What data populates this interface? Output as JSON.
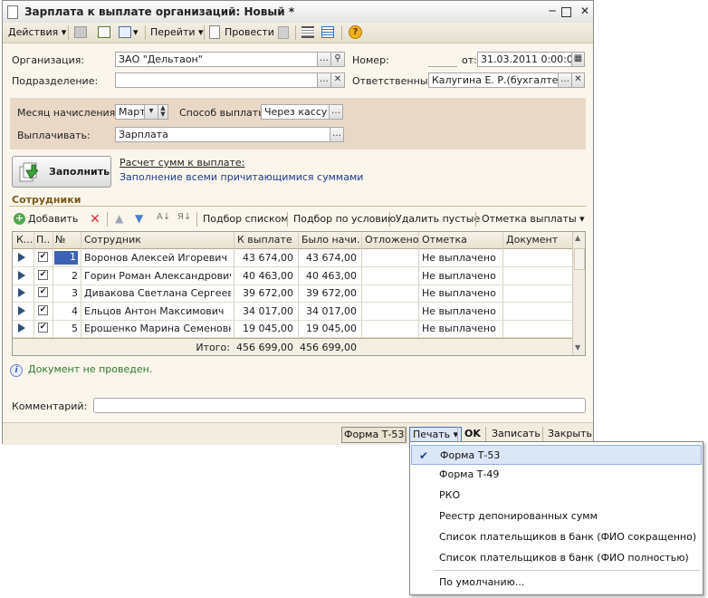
{
  "window": {
    "title": "Зарплата к выплате организаций: Новый *"
  },
  "toolbar": {
    "actions": "Действия",
    "goto": "Перейти",
    "post": "Провести"
  },
  "header": {
    "org_label": "Организация:",
    "org_value": "ЗАО \"Дельтаон\"",
    "dept_label": "Подразделение:",
    "dept_value": "",
    "number_label": "Номер:",
    "number_value": "",
    "date_label": "от:",
    "date_value": "31.03.2011  0:00:00",
    "resp_label": "Ответственный:",
    "resp_value": "Калугина Е. Р.(бухгалтер-ра..."
  },
  "params": {
    "month_label": "Месяц начисления:",
    "month_value": "Март",
    "method_label": "Способ выплаты:",
    "method_value": "Через кассу",
    "pay_label": "Выплачивать:",
    "pay_value": "Зарплата"
  },
  "fill": {
    "button": "Заполнить",
    "link1": "Расчет сумм к выплате:",
    "link2": "Заполнение всеми причитающимися суммами"
  },
  "employees": {
    "section_title": "Сотрудники",
    "toolbar": {
      "add": "Добавить",
      "pick_list": "Подбор списком",
      "pick_cond": "Подбор по условию",
      "delete_empty": "Удалить пустые",
      "mark_payment": "Отметка выплаты"
    },
    "columns": [
      "К...",
      "П...",
      "№",
      "Сотрудник",
      "К выплате",
      "Было начи...",
      "Отложено",
      "Отметка",
      "Документ"
    ],
    "rows": [
      {
        "n": "1",
        "name": "Воронов Алексей Игоревич",
        "pay": "43 674,00",
        "accrued": "43 674,00",
        "deferred": "",
        "mark": "Не выплачено",
        "doc": ""
      },
      {
        "n": "2",
        "name": "Горин Роман Александрович",
        "pay": "40 463,00",
        "accrued": "40 463,00",
        "deferred": "",
        "mark": "Не выплачено",
        "doc": ""
      },
      {
        "n": "3",
        "name": "Дивакова Светлана Сергеевна",
        "pay": "39 672,00",
        "accrued": "39 672,00",
        "deferred": "",
        "mark": "Не выплачено",
        "doc": ""
      },
      {
        "n": "4",
        "name": "Ельцов Антон Максимович",
        "pay": "34 017,00",
        "accrued": "34 017,00",
        "deferred": "",
        "mark": "Не выплачено",
        "doc": ""
      },
      {
        "n": "5",
        "name": "Ерошенко Марина Семеновна",
        "pay": "19 045,00",
        "accrued": "19 045,00",
        "deferred": "",
        "mark": "Не выплачено",
        "doc": ""
      }
    ],
    "total_label": "Итого:",
    "total_pay": "456 699,00",
    "total_accrued": "456 699,00"
  },
  "status": "Документ не проведен.",
  "comment_label": "Комментарий:",
  "comment_value": "",
  "bottom": {
    "form_t53": "Форма Т-53",
    "print": "Печать",
    "ok": "OK",
    "save": "Записать",
    "close": "Закрыть"
  },
  "print_menu": {
    "items": [
      "Форма Т-53",
      "Форма Т-49",
      "РКО",
      "Реестр депонированных сумм",
      "Список плательщиков в банк (ФИО сокращенно)",
      "Список плательщиков в банк (ФИО полностью)",
      "По умолчанию..."
    ]
  },
  "colors": {
    "window_bg": "#fbf6ec",
    "params_bg": "#ead8c6",
    "section_title": "#7a5a16",
    "link": "#1d3d8f",
    "status_ok": "#2e7a2e"
  }
}
